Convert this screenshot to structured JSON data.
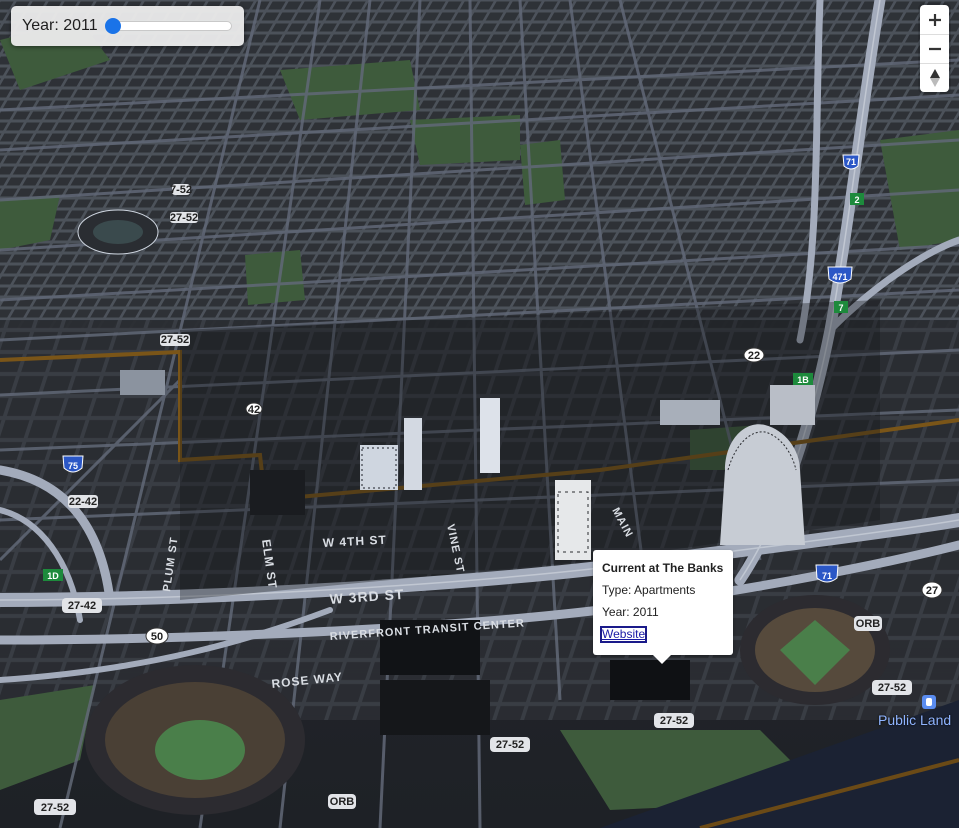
{
  "year_control": {
    "label_prefix": "Year:",
    "year": "2011",
    "slider_fraction": 0.0
  },
  "nav_control": {
    "zoom_in_icon": "plus-icon",
    "zoom_out_icon": "minus-icon",
    "compass_icon": "compass-icon"
  },
  "popup": {
    "title": "Current at The Banks",
    "type_line": "Type: Apartments",
    "year_line": "Year: 2011",
    "link_label": "Website"
  },
  "street_labels": {
    "w_4th": "W 4TH ST",
    "w_3rd": "W 3RD ST",
    "riverfront": "RIVERFRONT TRANSIT CENTER",
    "rose_way": "ROSE WAY",
    "plum": "PLUM ST",
    "elm": "ELM ST",
    "vine": "VINE ST",
    "main": "MAIN"
  },
  "poi": {
    "label": "Public Land",
    "icon": "park-pin-icon"
  },
  "route_shields": {
    "i75": "75",
    "i71": "71",
    "i471": "471",
    "i71_north": "71",
    "exit_2": "2",
    "exit_7": "7",
    "exit_1b": "1B",
    "exit_1d": "1D",
    "us22_a": "22",
    "us22_b": "22",
    "us50": "50",
    "us27": "27",
    "us42": "42",
    "s2752_a": "27-52",
    "s2752_b": "27-52",
    "s2752_c": "27-52",
    "s2752_d": "27-52",
    "s2752_e": "27-52",
    "s2752_f": "27-52",
    "s2742": "27-42",
    "s2242": "22-42",
    "orb_a": "ORB",
    "orb_b": "ORB",
    "s752": "7-52"
  },
  "colors": {
    "block": "#2d3035",
    "road": "#6f7786",
    "highway": "#9aa2b2",
    "park": "#3c5a3c",
    "river": "#1a1f2e",
    "accent": "#1a73e8",
    "brown_line": "#6b4a16"
  }
}
